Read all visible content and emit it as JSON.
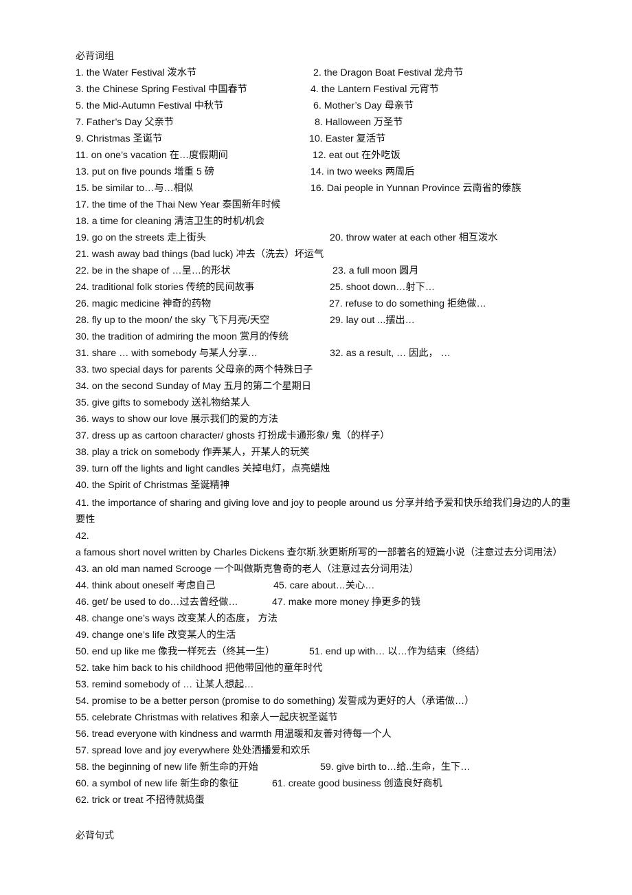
{
  "document": {
    "section_titles": {
      "phrases": "必背词组",
      "sentences": "必背句式"
    },
    "rows": [
      {
        "items": [
          {
            "num": "1.",
            "text": "the Water Festival 泼水节"
          },
          {
            "num": "2.",
            "text": "the Dragon Boat Festival 龙舟节"
          }
        ]
      },
      {
        "items": [
          {
            "num": "3.",
            "text": "the Chinese Spring Festival 中国春节"
          },
          {
            "num": "4.",
            "text": "the Lantern Festival 元宵节"
          }
        ]
      },
      {
        "items": [
          {
            "num": "5.",
            "text": "the Mid-Autumn Festival 中秋节"
          },
          {
            "num": "6.",
            "text": "Mother’s Day 母亲节"
          }
        ]
      },
      {
        "items": [
          {
            "num": "7.",
            "text": "Father’s Day 父亲节"
          },
          {
            "num": "8.",
            "text": "Halloween 万圣节"
          }
        ]
      },
      {
        "items": [
          {
            "num": "9.",
            "text": "Christmas 圣诞节"
          },
          {
            "num": "10.",
            "text": "Easter 复活节"
          }
        ]
      },
      {
        "items": [
          {
            "num": "11.",
            "text": "on one’s vacation 在…度假期间"
          },
          {
            "num": "12.",
            "text": "eat out 在外吃饭"
          }
        ]
      },
      {
        "items": [
          {
            "num": "13.",
            "text": "put on five pounds 增重 5 磅"
          },
          {
            "num": "14.",
            "text": "in two weeks 两周后"
          }
        ]
      },
      {
        "items": [
          {
            "num": "15.",
            "text": "be similar to…与…相似"
          },
          {
            "num": "16.",
            "text": "Dai people in Yunnan Province 云南省的傣族"
          }
        ]
      },
      {
        "items": [
          {
            "num": "17.",
            "text": "the time of the Thai New Year 泰国新年时候"
          }
        ]
      },
      {
        "items": [
          {
            "num": "18.",
            "text": "a time for cleaning 清洁卫生的时机/机会"
          }
        ]
      },
      {
        "items": [
          {
            "num": "19.",
            "text": "go on the streets 走上街头"
          },
          {
            "num": "20.",
            "text": "throw water at each other 相互泼水"
          }
        ]
      },
      {
        "items": [
          {
            "num": "21.",
            "text": "wash away bad things (bad luck) 冲去（洗去）坏运气"
          }
        ]
      },
      {
        "items": [
          {
            "num": "22.",
            "text": "be in the shape of …呈…的形状"
          },
          {
            "num": "23.",
            "text": "a full moon 圆月"
          }
        ]
      },
      {
        "items": [
          {
            "num": "24.",
            "text": "traditional folk stories 传统的民间故事"
          },
          {
            "num": "25.",
            "text": "shoot down…射下…"
          }
        ]
      },
      {
        "items": [
          {
            "num": "26.",
            "text": "magic medicine 神奇的药物"
          },
          {
            "num": "27.",
            "text": "refuse to do something 拒绝做…"
          }
        ]
      },
      {
        "items": [
          {
            "num": "28.",
            "text": "fly up to the moon/ the sky 飞下月亮/天空"
          },
          {
            "num": "29.",
            "text": "lay out ...摆出…"
          }
        ]
      },
      {
        "items": [
          {
            "num": "30.",
            "text": "the tradition of admiring the moon 赏月的传统"
          }
        ]
      },
      {
        "items": [
          {
            "num": "31.",
            "text": "share … with somebody 与某人分享…"
          },
          {
            "num": "32.",
            "text": "as a result, … 因此，  …"
          }
        ]
      },
      {
        "items": [
          {
            "num": "33.",
            "text": "two special days for parents 父母亲的两个特殊日子"
          }
        ]
      },
      {
        "items": [
          {
            "num": "34.",
            "text": "on the second Sunday of May 五月的第二个星期日"
          }
        ]
      },
      {
        "items": [
          {
            "num": "35.",
            "text": "give gifts to somebody 送礼物给某人"
          }
        ]
      },
      {
        "items": [
          {
            "num": "36.",
            "text": "ways to show our love 展示我们的爱的方法"
          }
        ]
      },
      {
        "items": [
          {
            "num": "37.",
            "text": "dress up as cartoon character/ ghosts 打扮成卡通形象/ 鬼（的样子）"
          }
        ]
      },
      {
        "items": [
          {
            "num": "38.",
            "text": "play a trick on somebody 作弄某人，开某人的玩笑"
          }
        ]
      },
      {
        "items": [
          {
            "num": "39.",
            "text": "turn off the lights and light candles 关掉电灯，点亮蜡烛"
          }
        ]
      },
      {
        "items": [
          {
            "num": "40.",
            "text": "the Spirit of Christmas 圣诞精神"
          }
        ]
      },
      {
        "items": [
          {
            "num": "41.",
            "text": "the importance of sharing and giving love and joy to people around us 分享并给予爱和快乐给我们身边的人的重要性"
          }
        ]
      },
      {
        "items": [
          {
            "num": "42.",
            "text": "a famous short novel written by Charles Dickens 查尔斯.狄更斯所写的一部著名的短篇小说（注意过去分词用法）"
          }
        ]
      },
      {
        "items": [
          {
            "num": "43.",
            "text": "an old man named Scrooge 一个叫做斯克鲁奇的老人（注意过去分词用法）"
          }
        ]
      },
      {
        "items": [
          {
            "num": "44.",
            "text": "think about oneself 考虑自己"
          },
          {
            "num": "45.",
            "text": "care about…关心…"
          }
        ]
      },
      {
        "items": [
          {
            "num": "46.",
            "text": "get/ be used to do…过去曾经做…"
          },
          {
            "num": "47.",
            "text": "make more money 挣更多的钱"
          }
        ]
      },
      {
        "items": [
          {
            "num": "48.",
            "text": "change one’s ways 改变某人的态度，  方法"
          }
        ]
      },
      {
        "items": [
          {
            "num": "49.",
            "text": "change one’s life 改变某人的生活"
          }
        ]
      },
      {
        "items": [
          {
            "num": "50.",
            "text": "end up like me 像我一样死去（终其一生）"
          },
          {
            "num": "51.",
            "text": "end up with… 以…作为结束（终结）"
          }
        ]
      },
      {
        "items": [
          {
            "num": "52.",
            "text": "take him back to his childhood 把他带回他的童年时代"
          }
        ]
      },
      {
        "items": [
          {
            "num": "53.",
            "text": "remind somebody of … 让某人想起…"
          }
        ]
      },
      {
        "items": [
          {
            "num": "54.",
            "text": "promise to be a better person (promise to do something) 发誓成为更好的人（承诺做…）"
          }
        ]
      },
      {
        "items": [
          {
            "num": "55.",
            "text": "celebrate Christmas with relatives 和亲人一起庆祝圣诞节"
          }
        ]
      },
      {
        "items": [
          {
            "num": "56.",
            "text": "tread everyone with kindness and warmth 用温暖和友善对待每一个人"
          }
        ]
      },
      {
        "items": [
          {
            "num": "57.",
            "text": "spread love and joy everywhere 处处洒播爱和欢乐"
          }
        ]
      },
      {
        "items": [
          {
            "num": "58.",
            "text": "the beginning of new life 新生命的开始"
          },
          {
            "num": "59.",
            "text": "give birth to…给..生命，生下…"
          }
        ]
      },
      {
        "items": [
          {
            "num": "60.",
            "text": "a symbol of new life 新生命的象征"
          },
          {
            "num": "61.",
            "text": "create good business 创造良好商机"
          }
        ]
      },
      {
        "items": [
          {
            "num": "62.",
            "text": "trick or treat 不招待就捣蛋"
          }
        ]
      }
    ]
  }
}
